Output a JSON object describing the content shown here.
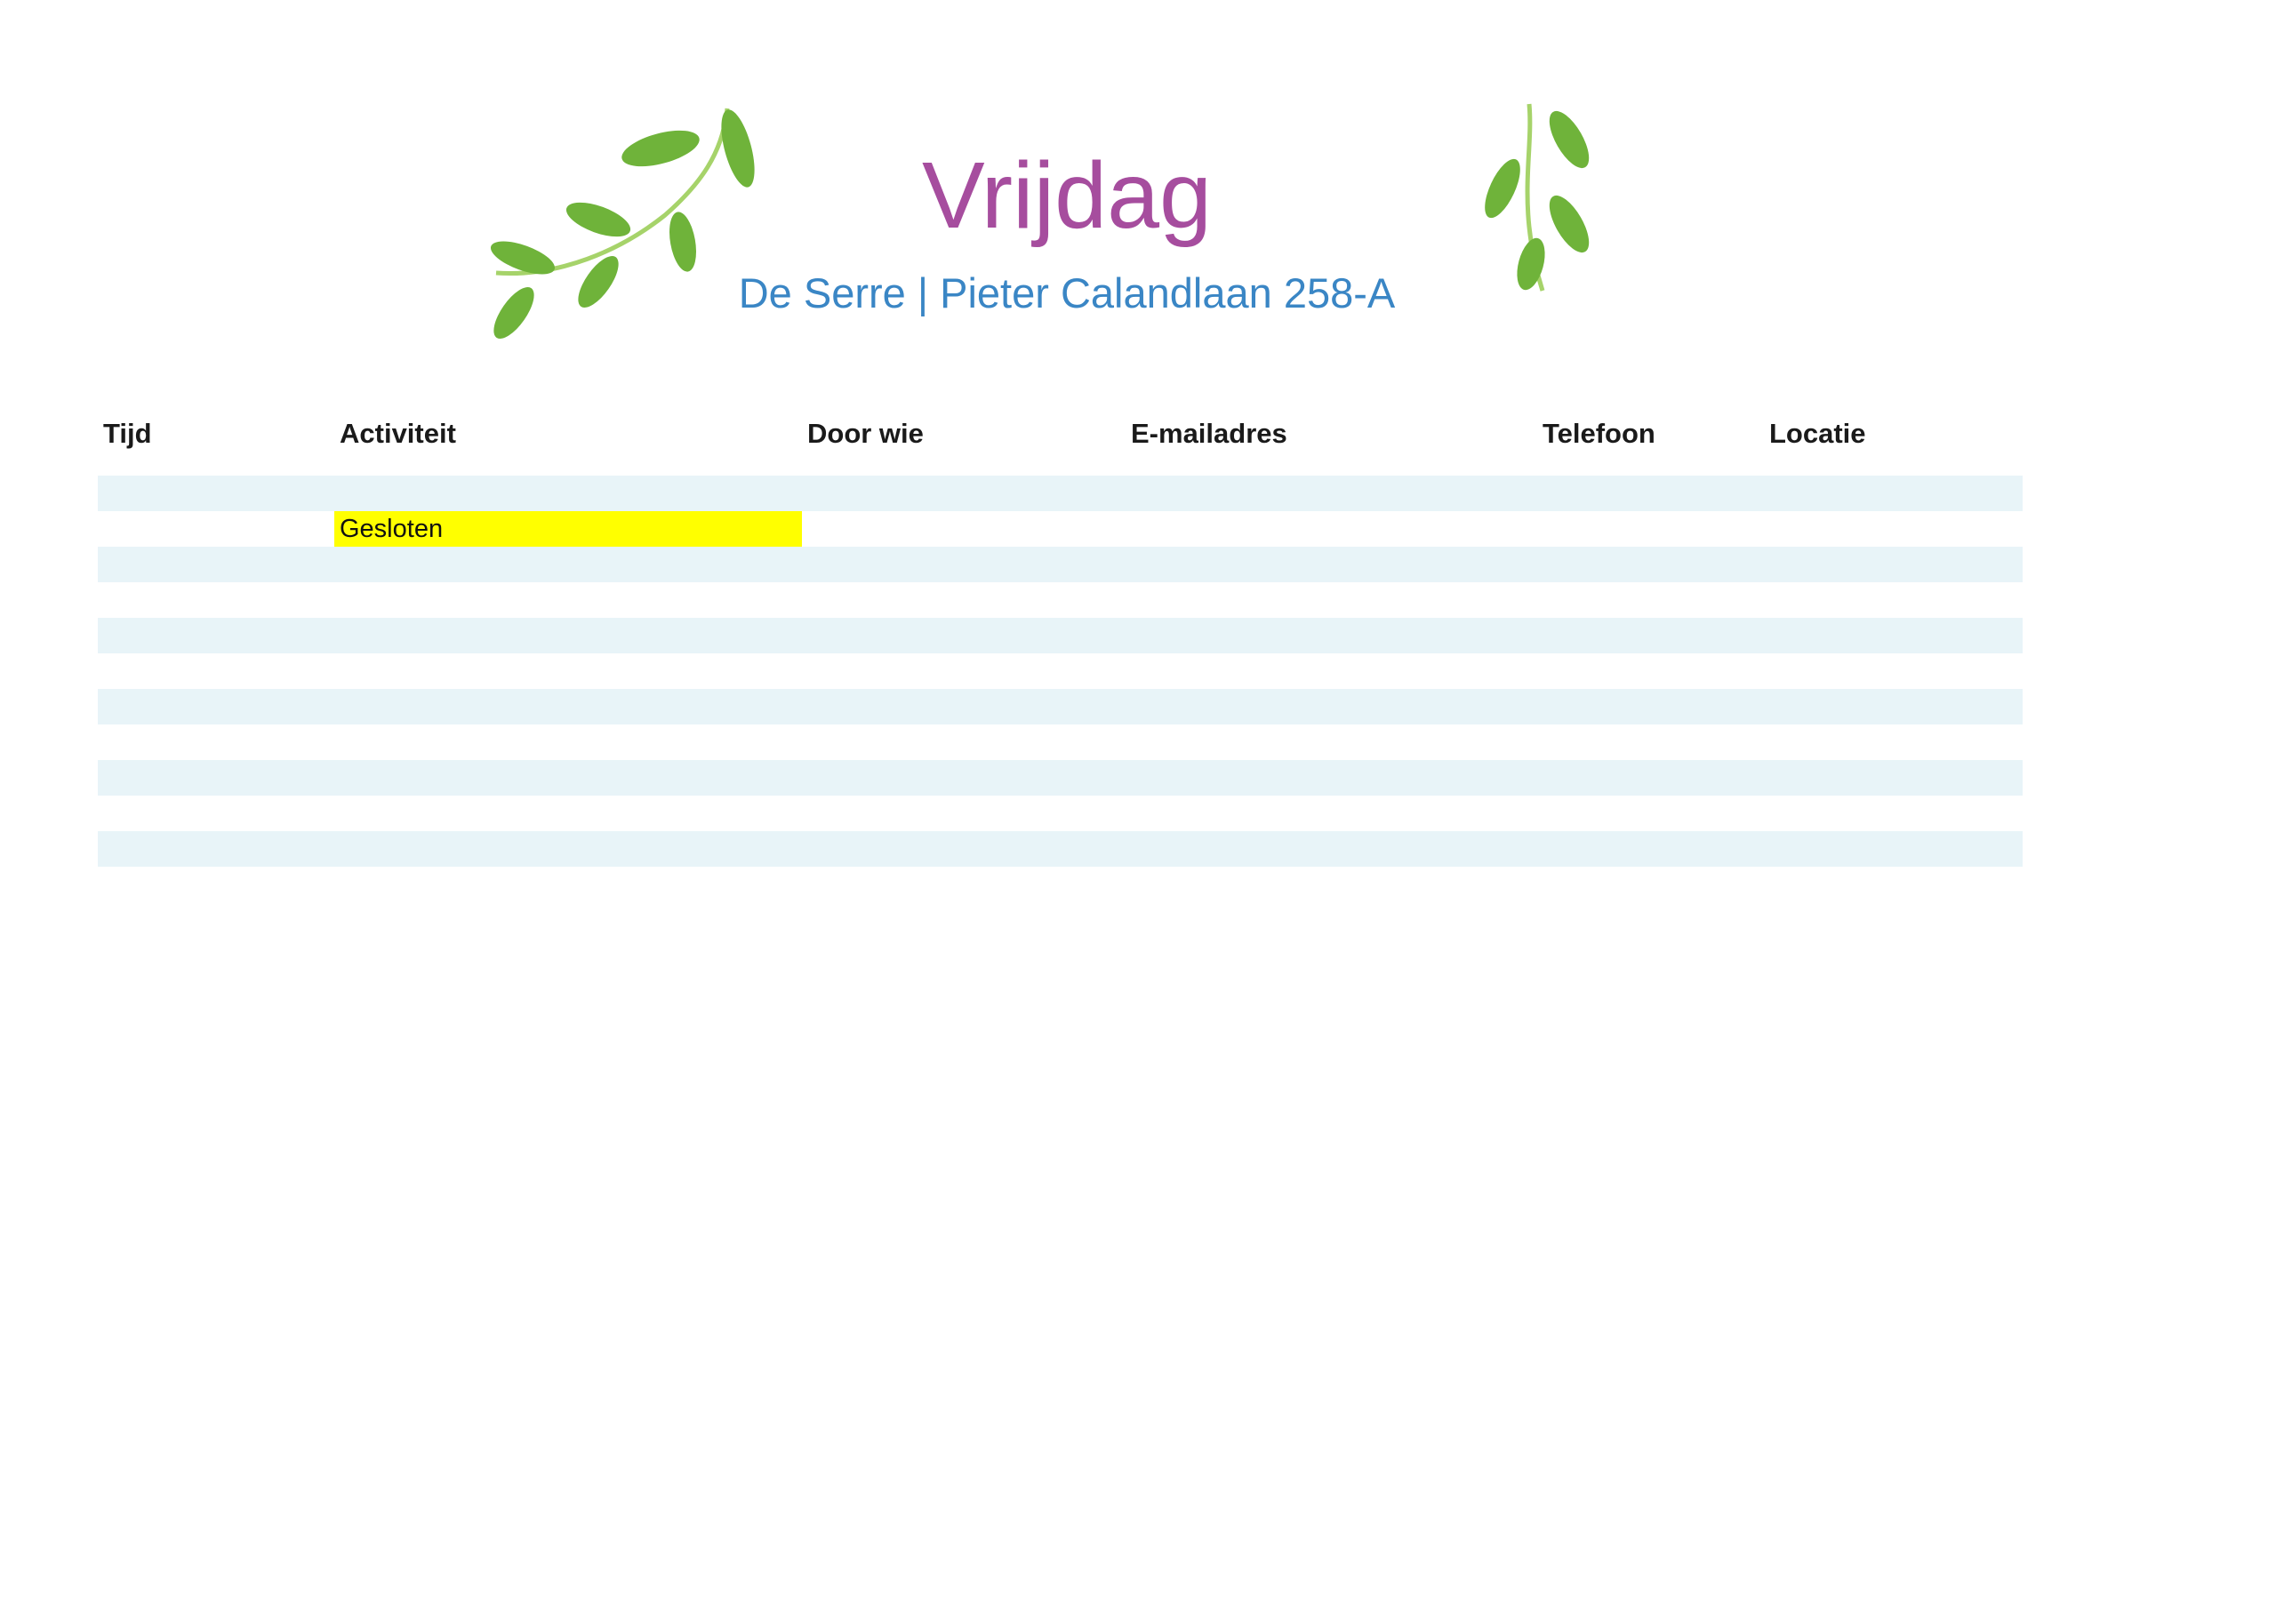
{
  "header": {
    "title": "Vrijdag",
    "subtitle": "De Serre | Pieter Calandlaan 258-A"
  },
  "decorations": {
    "left_icon": "leaf-branch-icon",
    "right_icon": "leaf-branch-icon",
    "leaf_color": "#7ab43c"
  },
  "table": {
    "columns": [
      "Tijd",
      "Activiteit",
      "Door wie",
      "E-mailadres",
      "Telefoon",
      "Locatie"
    ],
    "rows": [
      [
        "",
        "",
        "",
        "",
        "",
        ""
      ],
      [
        "",
        "Gesloten",
        "",
        "",
        "",
        ""
      ],
      [
        "",
        "",
        "",
        "",
        "",
        ""
      ],
      [
        "",
        "",
        "",
        "",
        "",
        ""
      ],
      [
        "",
        "",
        "",
        "",
        "",
        ""
      ],
      [
        "",
        "",
        "",
        "",
        "",
        ""
      ],
      [
        "",
        "",
        "",
        "",
        "",
        ""
      ],
      [
        "",
        "",
        "",
        "",
        "",
        ""
      ],
      [
        "",
        "",
        "",
        "",
        "",
        ""
      ],
      [
        "",
        "",
        "",
        "",
        "",
        ""
      ],
      [
        "",
        "",
        "",
        "",
        "",
        ""
      ]
    ],
    "highlight_color": "#ffff00",
    "stripe_color": "#e8f4f8"
  },
  "colors": {
    "title": "#a64d9e",
    "subtitle": "#3a86c5"
  }
}
